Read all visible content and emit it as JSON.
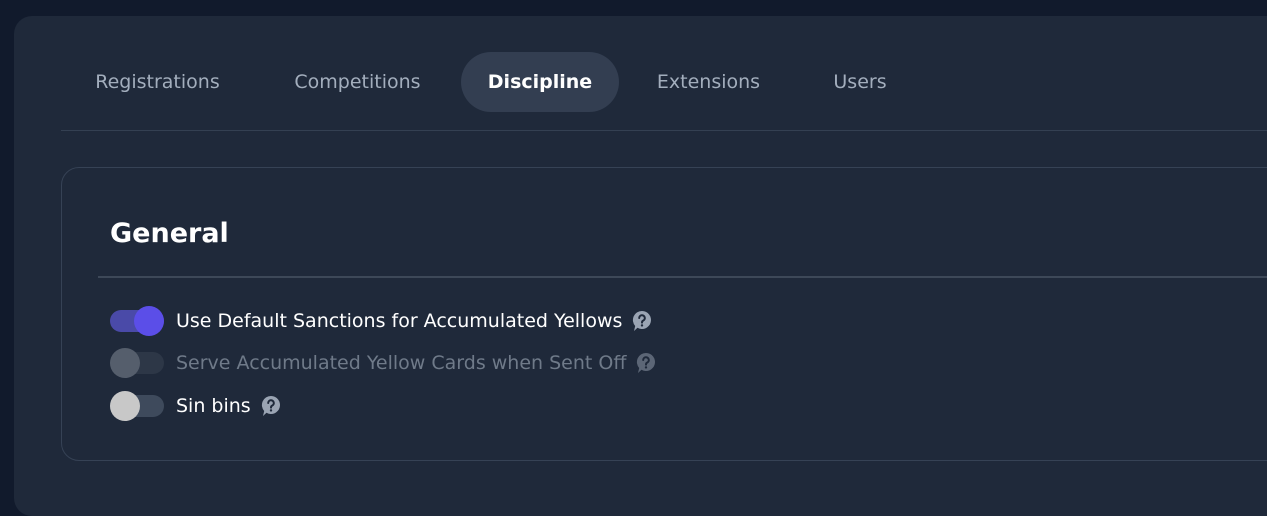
{
  "tabs": [
    {
      "label": "Registrations",
      "active": false
    },
    {
      "label": "Competitions",
      "active": false
    },
    {
      "label": "Discipline",
      "active": true
    },
    {
      "label": "Extensions",
      "active": false
    },
    {
      "label": "Users",
      "active": false
    }
  ],
  "section": {
    "title": "General",
    "settings": [
      {
        "label": "Use Default Sanctions for Accumulated Yellows",
        "state": "on",
        "enabled": true,
        "icon": "help-icon"
      },
      {
        "label": "Serve Accumulated Yellow Cards when Sent Off",
        "state": "off",
        "enabled": false,
        "icon": "help-icon"
      },
      {
        "label": "Sin bins",
        "state": "off",
        "enabled": true,
        "icon": "help-icon"
      }
    ]
  },
  "colors": {
    "background": "#111a2c",
    "panel": "#1f293a",
    "accent": "#5b4ee8",
    "active_tab": "#333e51"
  }
}
